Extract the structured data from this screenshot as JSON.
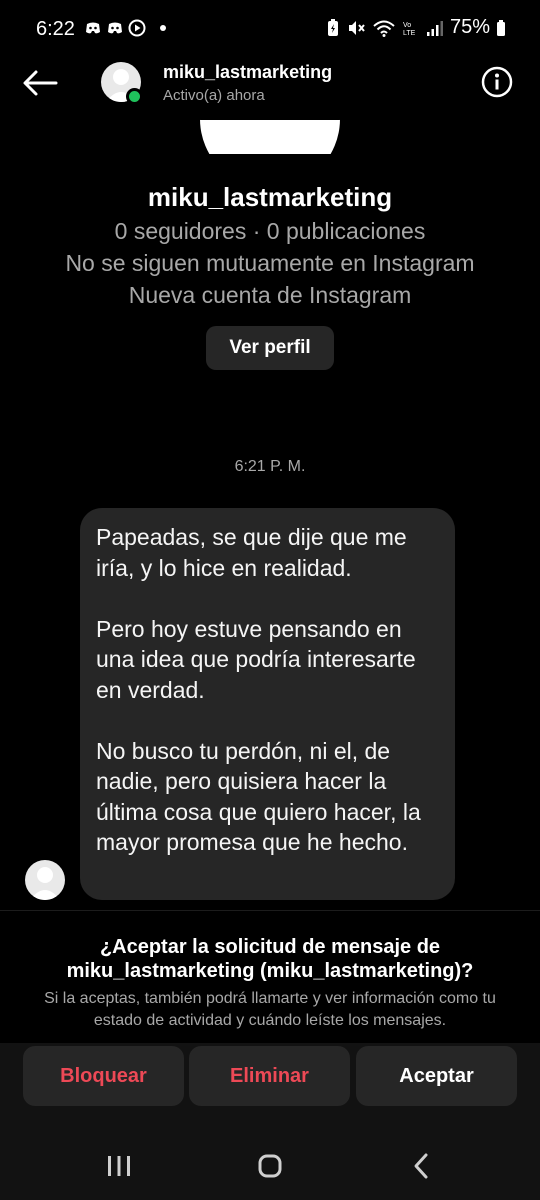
{
  "status_bar": {
    "time": "6:22",
    "battery": "75%",
    "left_icons": [
      "discord-icon",
      "discord-icon",
      "play-circle-icon"
    ],
    "right_icons": [
      "battery-saver-icon",
      "mute-icon",
      "wifi-icon",
      "volte-icon",
      "signal-icon",
      "battery-icon"
    ]
  },
  "header": {
    "username": "miku_lastmarketing",
    "status": "Activo(a) ahora"
  },
  "profile": {
    "name": "miku_lastmarketing",
    "stats": "0 seguidores · 0 publicaciones",
    "mutual": "No se siguen mutuamente en Instagram",
    "account_note": "Nueva cuenta de Instagram",
    "view_profile_label": "Ver perfil"
  },
  "conversation": {
    "timestamp": "6:21 P. M.",
    "message": "Papeadas, se que dije que me iría, y lo hice en realidad.\n\nPero hoy estuve pensando en una idea que podría interesarte en verdad.\n\nNo busco tu perdón, ni el, de nadie, pero quisiera hacer la última cosa que quiero hacer, la mayor promesa que he hecho."
  },
  "request": {
    "title": "¿Aceptar la solicitud de mensaje de miku_lastmarketing (miku_lastmarketing)?",
    "description": "Si la aceptas, también podrá llamarte y ver información como tu estado de actividad y cuándo leíste los mensajes.",
    "block_label": "Bloquear",
    "delete_label": "Eliminar",
    "accept_label": "Aceptar"
  },
  "colors": {
    "background": "#000000",
    "bubble": "#262626",
    "danger": "#ed4956",
    "online": "#1fc25c",
    "muted_text": "#a8a8a8"
  }
}
